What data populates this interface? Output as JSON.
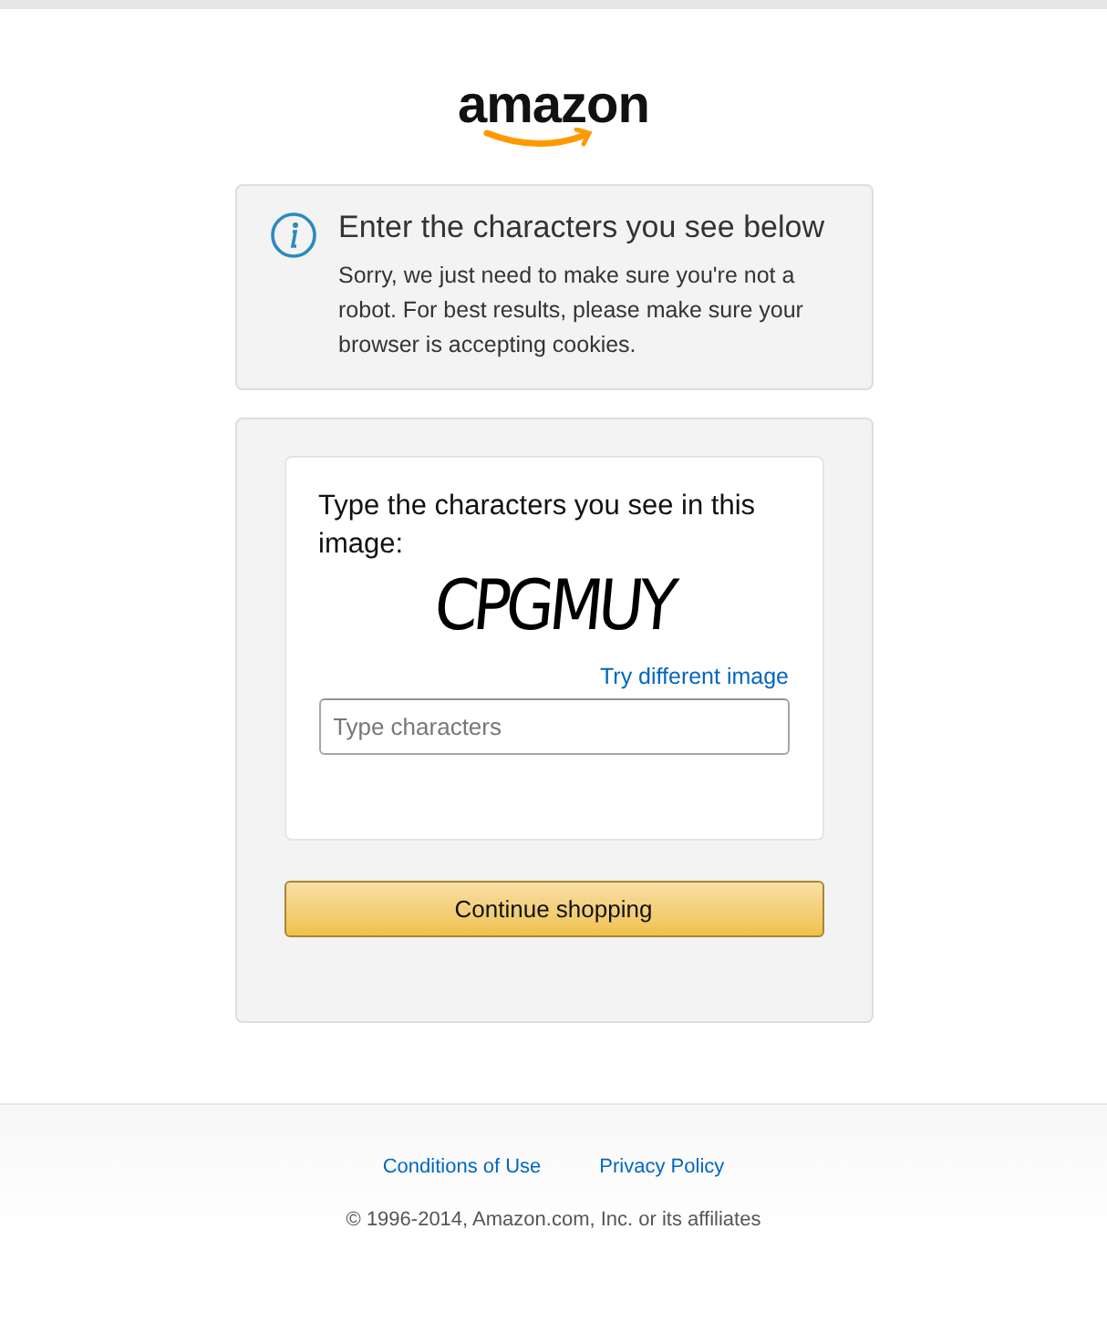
{
  "logo": {
    "text": "amazon"
  },
  "alert": {
    "title": "Enter the characters you see below",
    "message": "Sorry, we just need to make sure you're not a robot. For best results, please make sure your browser is accepting cookies."
  },
  "form": {
    "prompt": "Type the characters you see in this image:",
    "captcha": "CPGMUY",
    "different_image_link": "Try different image",
    "input": {
      "placeholder": "Type characters"
    },
    "button": "Continue shopping"
  },
  "footer": {
    "links": [
      "Conditions of Use",
      "Privacy Policy"
    ],
    "copyright": "© 1996-2014, Amazon.com, Inc. or its affiliates"
  }
}
